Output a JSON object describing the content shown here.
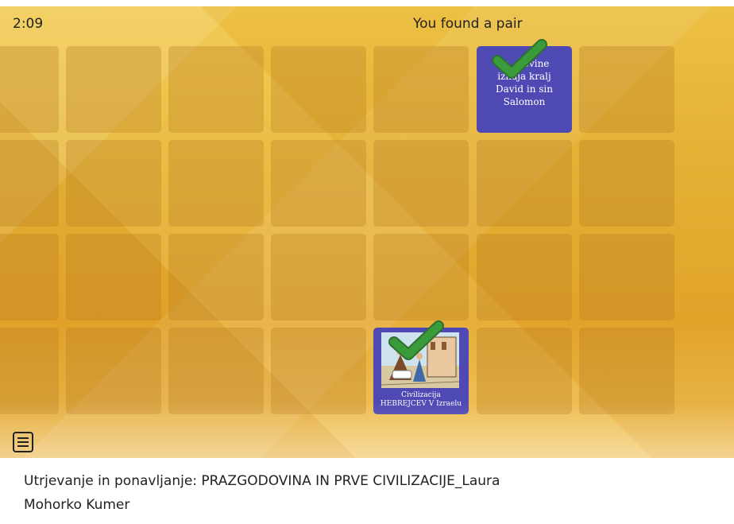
{
  "header": {
    "timer": "2:09",
    "status": "You found a pair"
  },
  "cards": [
    {
      "id": "r0c0",
      "state": "hidden"
    },
    {
      "id": "r0c1",
      "state": "hidden"
    },
    {
      "id": "r0c2",
      "state": "hidden"
    },
    {
      "id": "r0c3",
      "state": "hidden"
    },
    {
      "id": "r0c4",
      "state": "hidden"
    },
    {
      "id": "r0c5",
      "state": "matched",
      "text_lines": [
        "Iz ... ovine",
        "izhaja kralj",
        "David in sin",
        "Salomon"
      ]
    },
    {
      "id": "r0c6",
      "state": "hidden"
    },
    {
      "id": "r1c0",
      "state": "hidden"
    },
    {
      "id": "r1c1",
      "state": "hidden"
    },
    {
      "id": "r1c2",
      "state": "hidden"
    },
    {
      "id": "r1c3",
      "state": "hidden"
    },
    {
      "id": "r1c4",
      "state": "hidden"
    },
    {
      "id": "r1c5",
      "state": "hidden"
    },
    {
      "id": "r1c6",
      "state": "hidden"
    },
    {
      "id": "r2c0",
      "state": "hidden"
    },
    {
      "id": "r2c1",
      "state": "hidden"
    },
    {
      "id": "r2c2",
      "state": "hidden"
    },
    {
      "id": "r2c3",
      "state": "hidden"
    },
    {
      "id": "r2c4",
      "state": "hidden"
    },
    {
      "id": "r2c5",
      "state": "hidden"
    },
    {
      "id": "r2c6",
      "state": "hidden"
    },
    {
      "id": "r3c0",
      "state": "hidden"
    },
    {
      "id": "r3c1",
      "state": "hidden"
    },
    {
      "id": "r3c2",
      "state": "hidden"
    },
    {
      "id": "r3c3",
      "state": "hidden"
    },
    {
      "id": "r3c4",
      "state": "matched",
      "caption_lines": [
        "Civilizacija",
        "HEBREJCEV V Izraelu"
      ]
    },
    {
      "id": "r3c5",
      "state": "hidden"
    },
    {
      "id": "r3c6",
      "state": "hidden"
    }
  ],
  "menu": {
    "icon": "menu-icon"
  },
  "footer": {
    "line1": "Utrjevanje in ponavljanje: PRAZGODOVINA IN PRVE CIVILIZACIJE_Laura",
    "line2": "Mohorko Kumer"
  },
  "colors": {
    "card_revealed": "#4f49b3",
    "check": "#3a9b3a"
  }
}
